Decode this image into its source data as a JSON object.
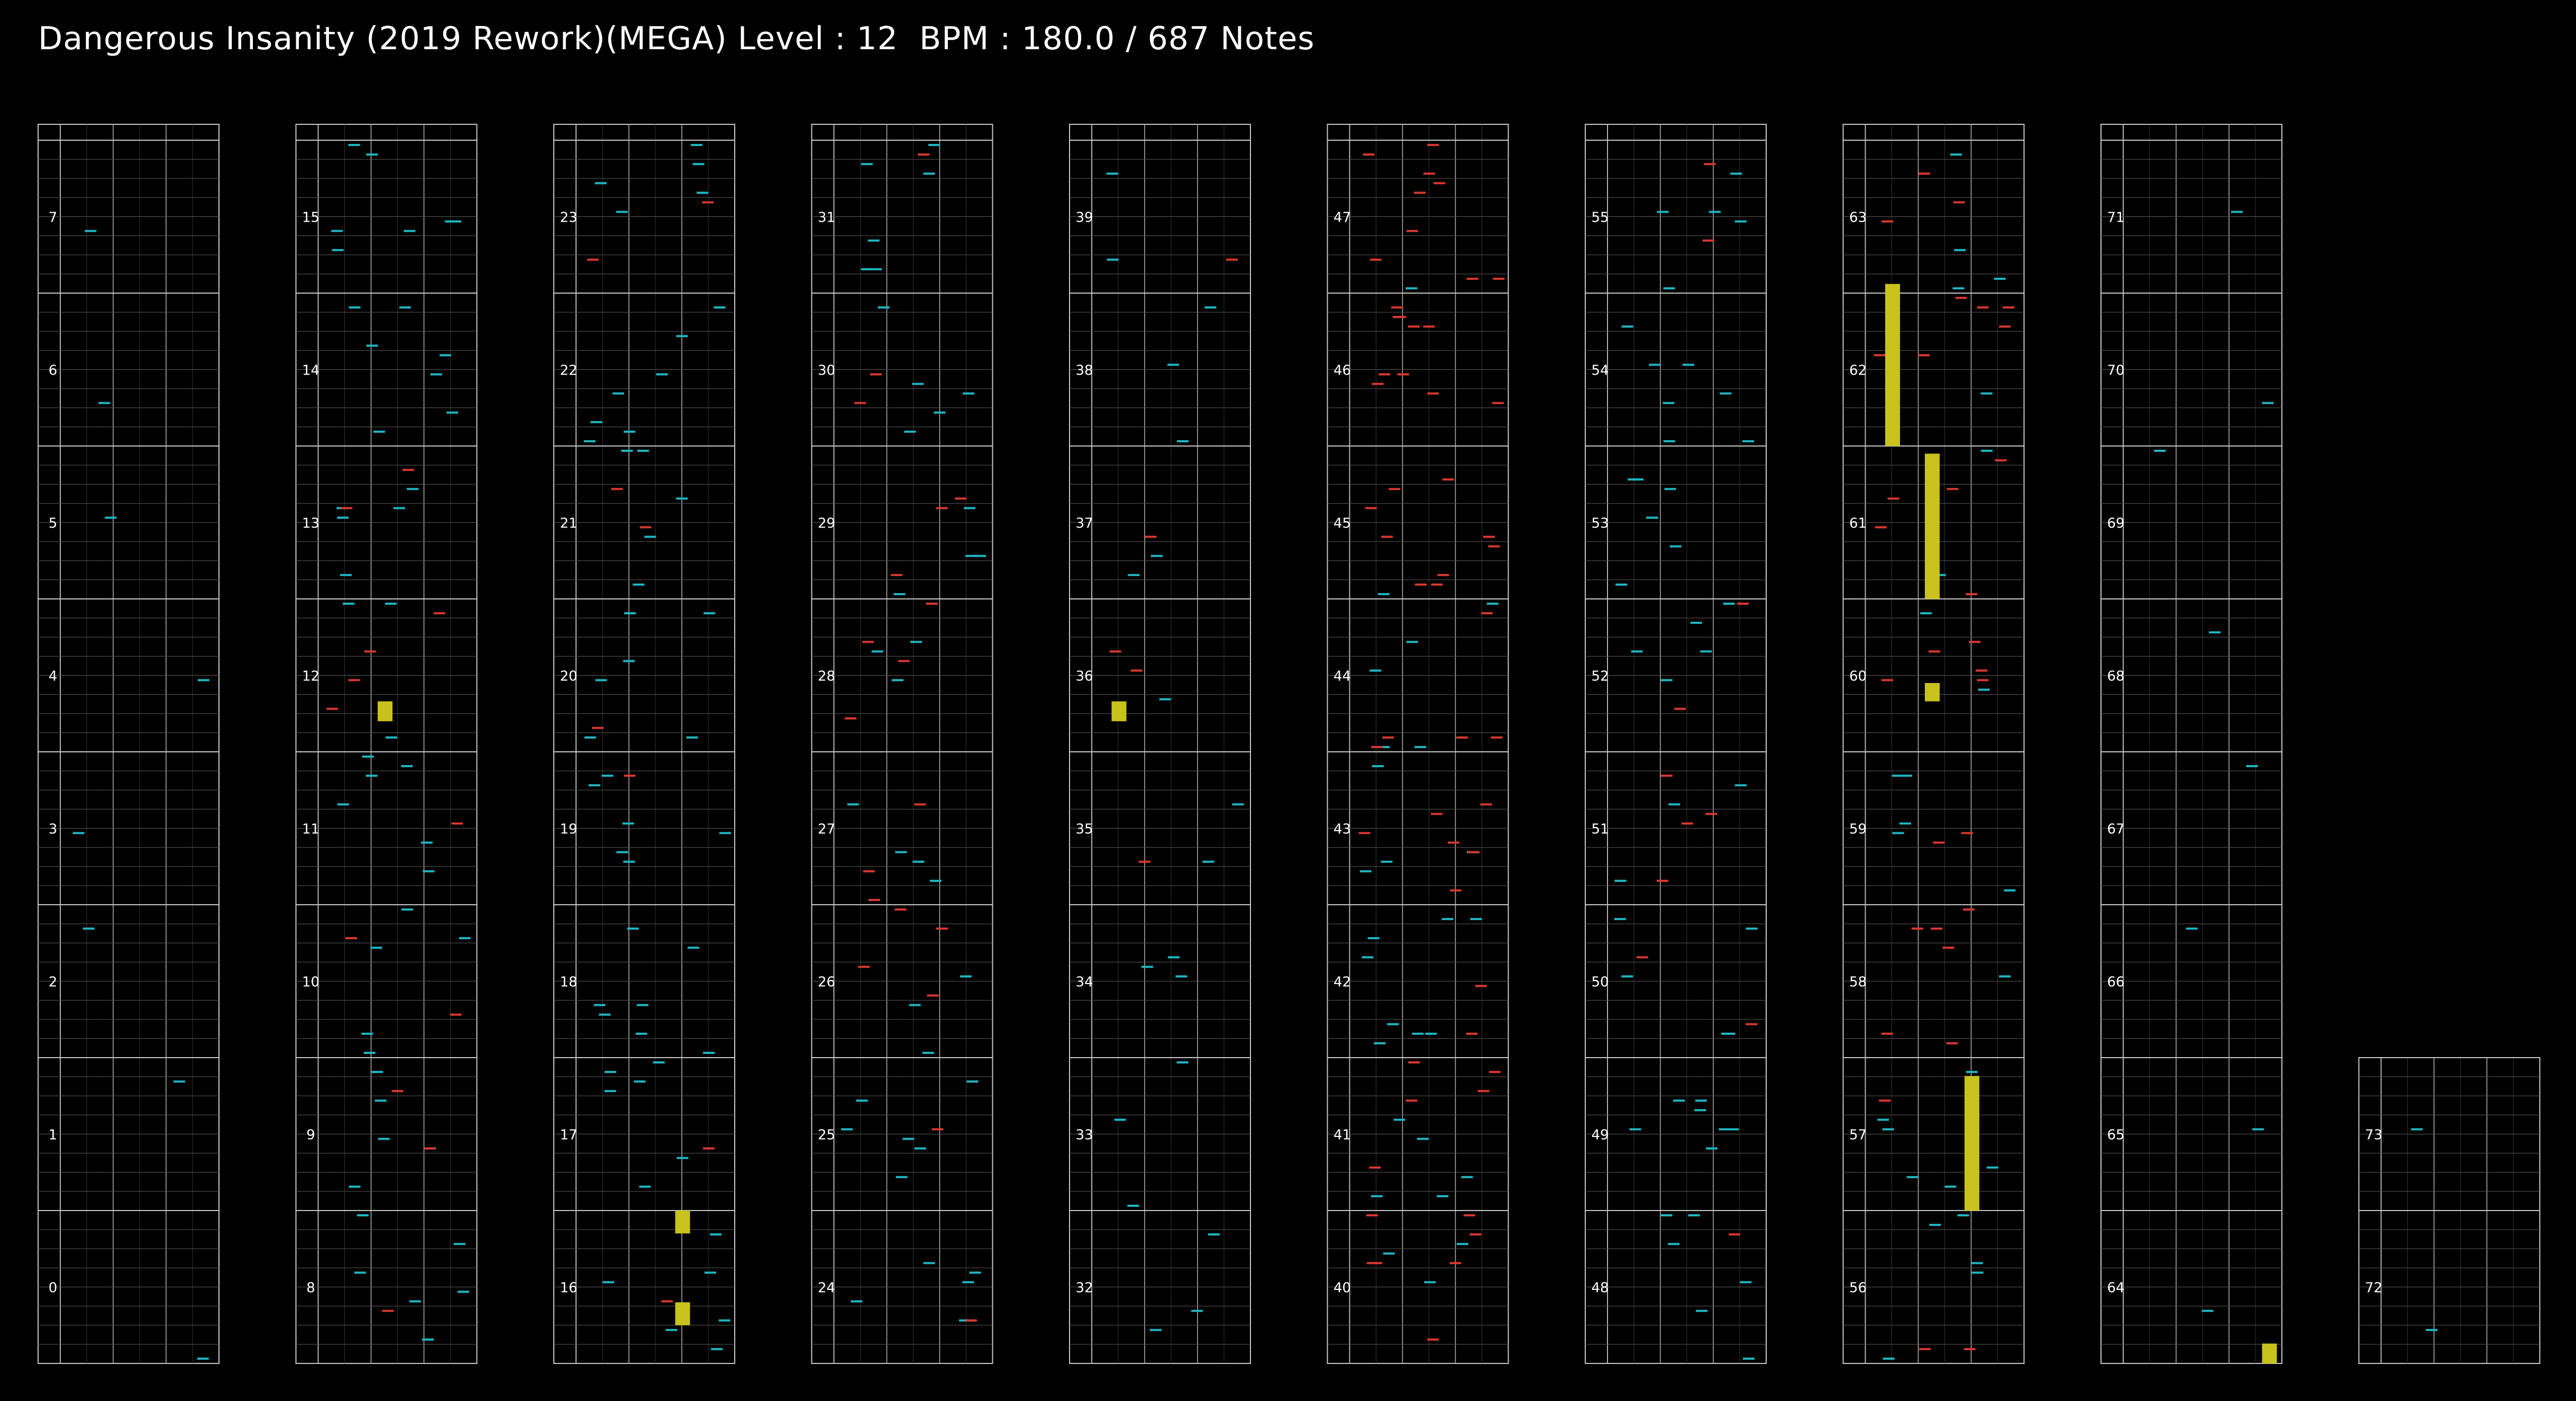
{
  "header": {
    "song_title": "Dangerous Insanity (2019 Rework)(MEGA)",
    "level_text": "Level : 12",
    "bpm_text": "BPM : 180.0",
    "notes_text": "/ 687 Notes"
  },
  "chart_meta": {
    "total_measures": 74,
    "measures_per_column": 8,
    "lanes": 4,
    "subdivisions_per_measure": 8,
    "colors": {
      "background": "#000000",
      "measure_line": "#c8c8c8",
      "beat_line": "#5a5a5a",
      "lane_line": "#b4b4b4",
      "tap_note": "#1fb6c2",
      "flick_note": "#d8382f",
      "hold_note": "#c9c21c"
    }
  },
  "chart_data": {
    "type": "table",
    "measure_labels": [
      "0",
      "1",
      "2",
      "3",
      "4",
      "5",
      "6",
      "7",
      "8",
      "9",
      "10",
      "11",
      "12",
      "13",
      "14",
      "15",
      "16",
      "17",
      "18",
      "19",
      "20",
      "21",
      "22",
      "23",
      "24",
      "25",
      "26",
      "27",
      "28",
      "29",
      "30",
      "31",
      "32",
      "33",
      "34",
      "35",
      "36",
      "37",
      "38",
      "39",
      "40",
      "41",
      "42",
      "43",
      "44",
      "45",
      "46",
      "47",
      "48",
      "49",
      "50",
      "51",
      "52",
      "53",
      "54",
      "55",
      "56",
      "57",
      "58",
      "59",
      "60",
      "61",
      "62",
      "63",
      "64",
      "65",
      "66",
      "67",
      "68",
      "69",
      "70",
      "71",
      "72",
      "73"
    ],
    "hold_notes": [
      {
        "measure_start": 12.2,
        "measure_end": 12.33,
        "lane": "2-3"
      },
      {
        "measure_start": 16.85,
        "measure_end": 17.0,
        "lane": "3"
      },
      {
        "measure_start": 16.25,
        "measure_end": 16.4,
        "lane": "3"
      },
      {
        "measure_start": 36.2,
        "measure_end": 36.33,
        "lane": "1"
      },
      {
        "measure_start": 57.0,
        "measure_end": 57.88,
        "lane": "3"
      },
      {
        "measure_start": 60.33,
        "measure_end": 60.45,
        "lane": "2"
      },
      {
        "measure_start": 61.0,
        "measure_end": 61.95,
        "lane": "2"
      },
      {
        "measure_start": 62.0,
        "measure_end": 63.06,
        "lane": "1"
      },
      {
        "measure_start": 64.0,
        "measure_end": 64.13,
        "lane": "4"
      }
    ]
  }
}
